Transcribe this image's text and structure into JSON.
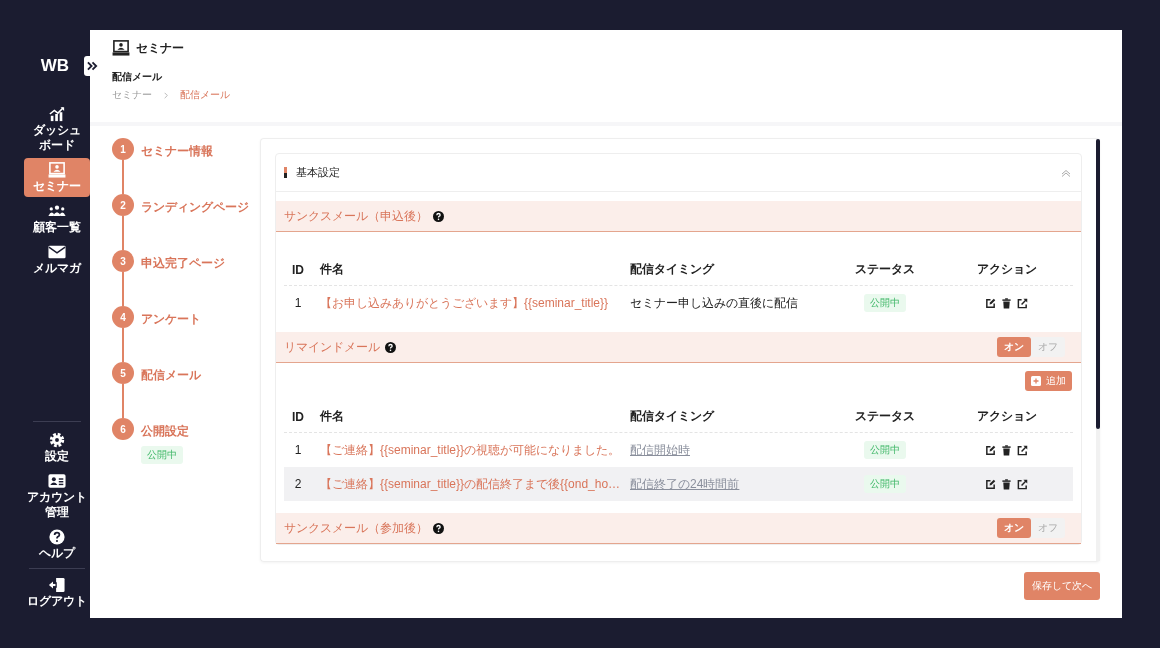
{
  "sidebar": {
    "logo": "WB",
    "nav_items": [
      {
        "lines": [
          "ダッシュ",
          "ボード"
        ],
        "selected": false
      },
      {
        "lines": [
          "セミナー"
        ],
        "selected": true
      },
      {
        "lines": [
          "顧客一覧"
        ],
        "selected": false
      },
      {
        "lines": [
          "メルマガ"
        ],
        "selected": false
      }
    ],
    "bottom_items": [
      {
        "lines": [
          "設定"
        ],
        "selected": false
      },
      {
        "lines": [
          "アカウント",
          "管理"
        ],
        "selected": false
      },
      {
        "lines": [
          "ヘルプ"
        ],
        "selected": false
      }
    ],
    "logout": "ログアウト"
  },
  "header": {
    "title": "セミナー",
    "subtitle": "配信メール",
    "breadcrumb": [
      {
        "label": "セミナー",
        "current": false
      },
      {
        "label": "配信メール",
        "current": true
      }
    ]
  },
  "steps": [
    {
      "number": "1",
      "label": "セミナー情報"
    },
    {
      "number": "2",
      "label": "ランディングページ"
    },
    {
      "number": "3",
      "label": "申込完了ページ"
    },
    {
      "number": "4",
      "label": "アンケート"
    },
    {
      "number": "5",
      "label": "配信メール"
    },
    {
      "number": "6",
      "label": "公開設定",
      "badge": "公開中"
    }
  ],
  "card": {
    "title": "基本設定",
    "expanded": true,
    "sections": [
      {
        "title": "サンクスメール（申込後）",
        "columns": [
          "ID",
          "件名",
          "配信タイミング",
          "ステータス",
          "アクション"
        ],
        "rows": [
          {
            "id": "1",
            "subject": "【お申し込みありがとうございます】{{seminar_title}}",
            "timing": "セミナー申し込みの直後に配信",
            "timing_link": false,
            "status": "公開中",
            "highlighted": false
          }
        ]
      },
      {
        "title": "リマインドメール",
        "toggle": [
          {
            "label": "オン",
            "selected": true
          },
          {
            "label": "オフ",
            "selected": false
          }
        ],
        "add_button": "追加",
        "columns": [
          "ID",
          "件名",
          "配信タイミング",
          "ステータス",
          "アクション"
        ],
        "rows": [
          {
            "id": "1",
            "subject": "【ご連絡】{{seminar_title}}の視聴が可能になりました。",
            "timing": "配信開始時",
            "timing_link": true,
            "status": "公開中",
            "highlighted": false
          },
          {
            "id": "2",
            "subject": "【ご連絡】{{seminar_title}}の配信終了まで後{{ond_ho…",
            "timing": "配信終了の24時間前",
            "timing_link": true,
            "status": "公開中",
            "highlighted": true
          }
        ]
      },
      {
        "title": "サンクスメール（参加後）",
        "toggle": [
          {
            "label": "オン",
            "selected": true
          },
          {
            "label": "オフ",
            "selected": false
          }
        ]
      }
    ]
  },
  "save_button": "保存して次へ"
}
